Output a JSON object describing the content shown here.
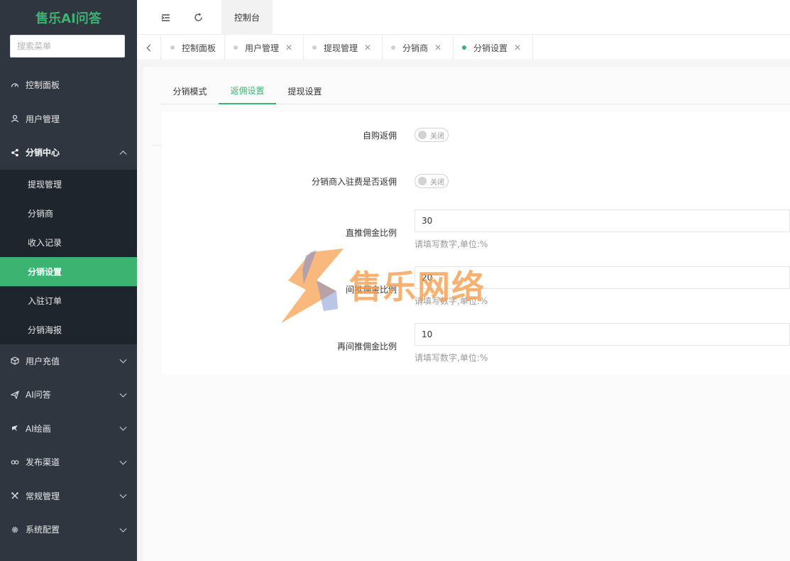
{
  "brand": {
    "title": "售乐AI问答"
  },
  "sidebar": {
    "search_placeholder": "搜索菜单",
    "items": [
      {
        "label": "控制面板",
        "icon": "dashboard-icon"
      },
      {
        "label": "用户管理",
        "icon": "user-icon"
      },
      {
        "label": "分销中心",
        "icon": "share-icon",
        "open": true
      },
      {
        "label": "用户充值",
        "icon": "box-icon"
      },
      {
        "label": "AI问答",
        "icon": "send-icon"
      },
      {
        "label": "AI绘画",
        "icon": "paint-icon"
      },
      {
        "label": "发布渠道",
        "icon": "link-icon"
      },
      {
        "label": "常规管理",
        "icon": "tools-icon"
      },
      {
        "label": "系统配置",
        "icon": "gear-icon"
      }
    ],
    "submenu": [
      "提现管理",
      "分销商",
      "收入记录",
      "分销设置",
      "入驻订单",
      "分销海报"
    ],
    "active_sub": "分销设置"
  },
  "topbar": {
    "tab": "控制台"
  },
  "tags": [
    {
      "label": "控制面板"
    },
    {
      "label": "用户管理"
    },
    {
      "label": "提现管理"
    },
    {
      "label": "分销商"
    },
    {
      "label": "分销设置",
      "active": true
    }
  ],
  "tabs": [
    "分销模式",
    "返佣设置",
    "提现设置"
  ],
  "active_tab": "返佣设置",
  "form": {
    "self_rebate": {
      "label": "自购返佣",
      "switch_text": "关闭"
    },
    "settle_rebate": {
      "label": "分销商入驻费是否返佣",
      "switch_text": "关闭"
    },
    "direct": {
      "label": "直推佣金比例",
      "value": "30",
      "hint": "请填写数字,单位:%"
    },
    "indirect": {
      "label": "间推佣金比例",
      "value": "20",
      "hint": "请填写数字,单位:%"
    },
    "third": {
      "label": "再间推佣金比例",
      "value": "10",
      "hint": "请填写数字,单位:%"
    }
  },
  "watermark": {
    "text": "售乐网络"
  },
  "colors": {
    "accent": "#3cb371",
    "sidebar_bg": "#2f3640",
    "submenu_bg": "#1f252d"
  }
}
